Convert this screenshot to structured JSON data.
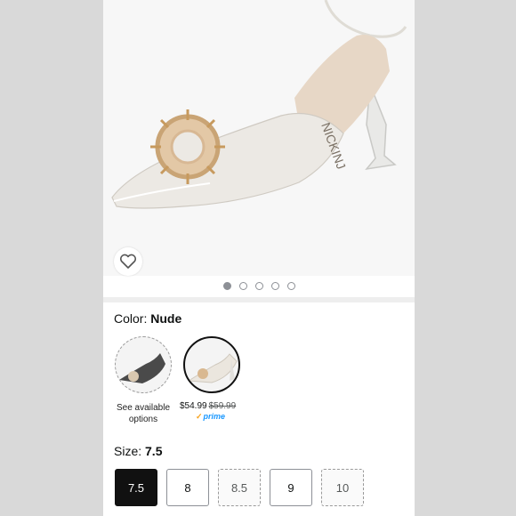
{
  "product": {
    "image_alt": "Clear pointed-toe pump with jeweled brooch"
  },
  "color": {
    "label": "Color: ",
    "value": "Nude"
  },
  "options": [
    {
      "caption": "See available options"
    },
    {
      "price": "$54.99",
      "list_price": "$59.99",
      "badge": "prime"
    }
  ],
  "size": {
    "label": "Size: ",
    "value": "7.5",
    "choices": [
      "7.5",
      "8",
      "8.5",
      "9",
      "10"
    ]
  },
  "icons": {
    "favorite": "heart-outline-icon",
    "prime": "prime-check-icon"
  },
  "colors": {
    "selected_border": "#111111",
    "prime_blue": "#1a98ff",
    "pager_active": "#8d9096"
  }
}
